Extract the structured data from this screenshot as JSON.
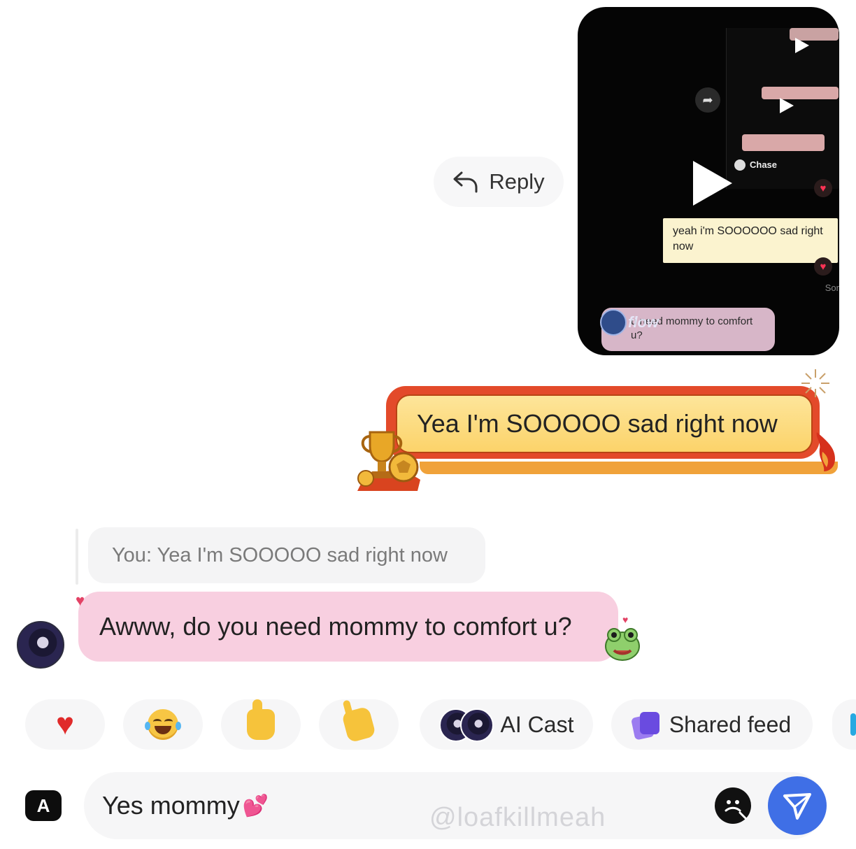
{
  "video_message": {
    "inner_sender": "Chase",
    "inner_bubble_1": "yeah i'm SOOOOOO sad right now",
    "inner_bubble_2": "u need mommy to comfort u?",
    "overlay_brand": "flow",
    "edge_text": "Sor"
  },
  "reply_button": {
    "label": "Reply"
  },
  "sent_message": {
    "text": "Yea I'm SOOOOO sad right now"
  },
  "quoted_reply": {
    "text": "You: Yea I'm SOOOOO sad right now"
  },
  "received_message": {
    "text": "Awww, do you need mommy to comfort u?"
  },
  "quick_actions": [
    {
      "icon": "red-heart-icon"
    },
    {
      "icon": "tears-of-joy-icon"
    },
    {
      "icon": "thumbs-up-icon"
    },
    {
      "icon": "pointing-hand-icon"
    },
    {
      "icon": "ai-cast-avatars",
      "label": "AI Cast"
    },
    {
      "icon": "shared-feed-icon",
      "label": "Shared feed"
    }
  ],
  "composer": {
    "keyboard_badge": "A",
    "value": "Yes mommy",
    "value_emoji": "💕",
    "watermark": "@loafkillmeah"
  },
  "colors": {
    "send_button": "#3f6fe6",
    "received_bubble": "#f8cfe0",
    "sent_bubble": "#fcd36a",
    "sent_bubble_border": "#e34a2a"
  }
}
